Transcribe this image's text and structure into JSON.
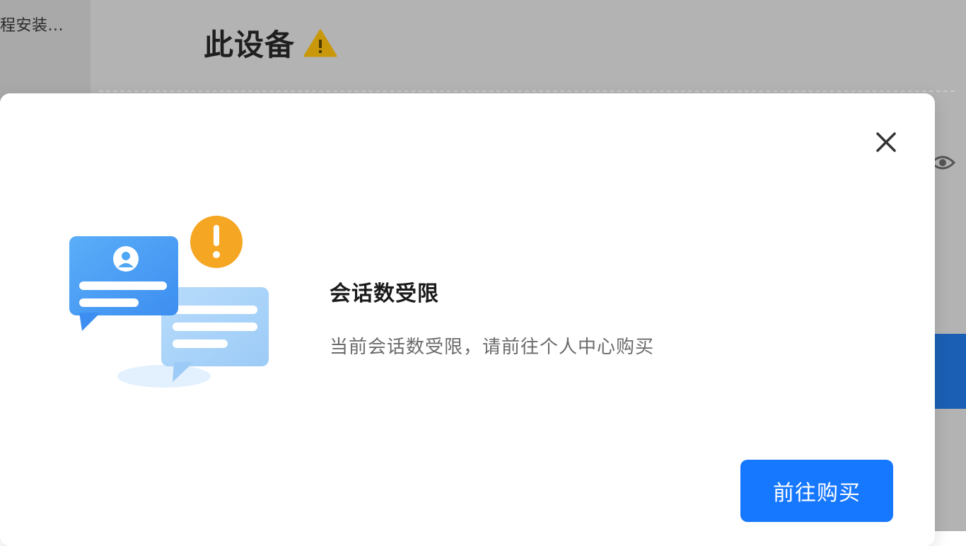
{
  "sidebar": {
    "item_label": "程安装..."
  },
  "page": {
    "title": "此设备"
  },
  "dialog": {
    "title": "会话数受限",
    "message": "当前会话数受限，请前往个人中心购买",
    "buy_button": "前往购买"
  },
  "colors": {
    "primary": "#1677ff",
    "warning": "#f5a623",
    "bubble_blue": "#4fa7f5",
    "backdrop": "#b3b3b3"
  },
  "icons": {
    "heading": "warning-triangle-icon",
    "close": "close-icon",
    "right_edge": "eye-icon",
    "illustration": "chat-bubbles-warning-illustration"
  }
}
